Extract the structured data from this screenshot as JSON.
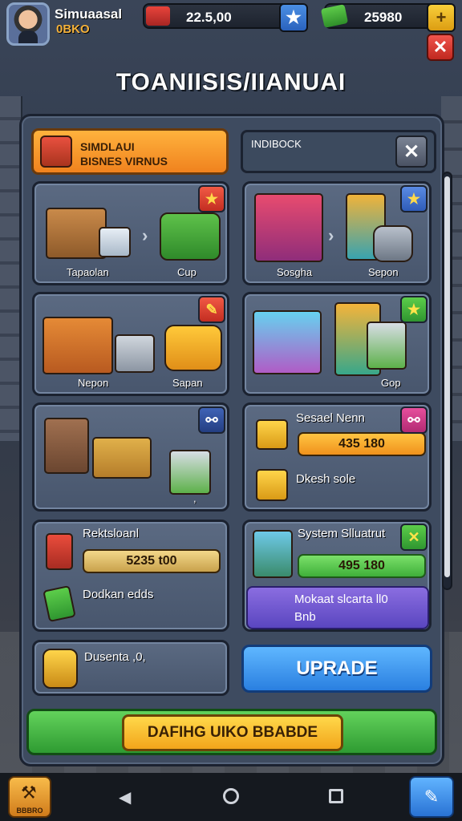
{
  "player": {
    "name": "Simuaasal",
    "subtitle": "0BKO"
  },
  "resources": {
    "cash": {
      "value": "22.5,00",
      "button_icon": "star"
    },
    "gems": {
      "value": "25980",
      "button_icon": "plus"
    }
  },
  "screen": {
    "title": "TOANIISIS/IIANUAI"
  },
  "select_button": {
    "line1": "SIMDLAUI",
    "line2": "BISNES VIRNUS"
  },
  "index_box": {
    "label": "INDIBOCK",
    "close_glyph": "✕"
  },
  "cards": [
    {
      "label_left": "Tapaolan",
      "label_right": "Cup",
      "badge": "red-star"
    },
    {
      "label_left": "Sosgha",
      "label_right": "Sepon",
      "badge": "blue-star"
    },
    {
      "label_left": "Nepon",
      "label_right": "Sapan",
      "badge": "red-ticket"
    },
    {
      "label_left": "",
      "label_right": "Gop",
      "badge": "green-star"
    },
    {
      "label_left": "",
      "label_right": ",",
      "badge": "navy-link"
    },
    {
      "title": "Sesael Nenn",
      "value": "435 180",
      "sub": "Dkesh sole",
      "badge": "pink-link"
    }
  ],
  "reports": {
    "title": "Rektsloanl",
    "value": "5235 t00",
    "sub": "Dodkan edds"
  },
  "system": {
    "title": "System Slluatrut",
    "value": "495 180",
    "note_line1": "Mokaat slcarta ll0",
    "note_line2": "Bnb"
  },
  "deposit": {
    "label": "Dusenta ,0,"
  },
  "upgrade_label": "UPRADE",
  "main_action_label": "DAFIHG UIKO BBABDE",
  "nav": {
    "left_label": "BBBRO"
  },
  "colors": {
    "accent_orange": "#f0821e",
    "accent_blue": "#2a7fe0",
    "accent_green": "#2f9b32",
    "danger_red": "#c0281f",
    "panel": "#3e4b60"
  }
}
